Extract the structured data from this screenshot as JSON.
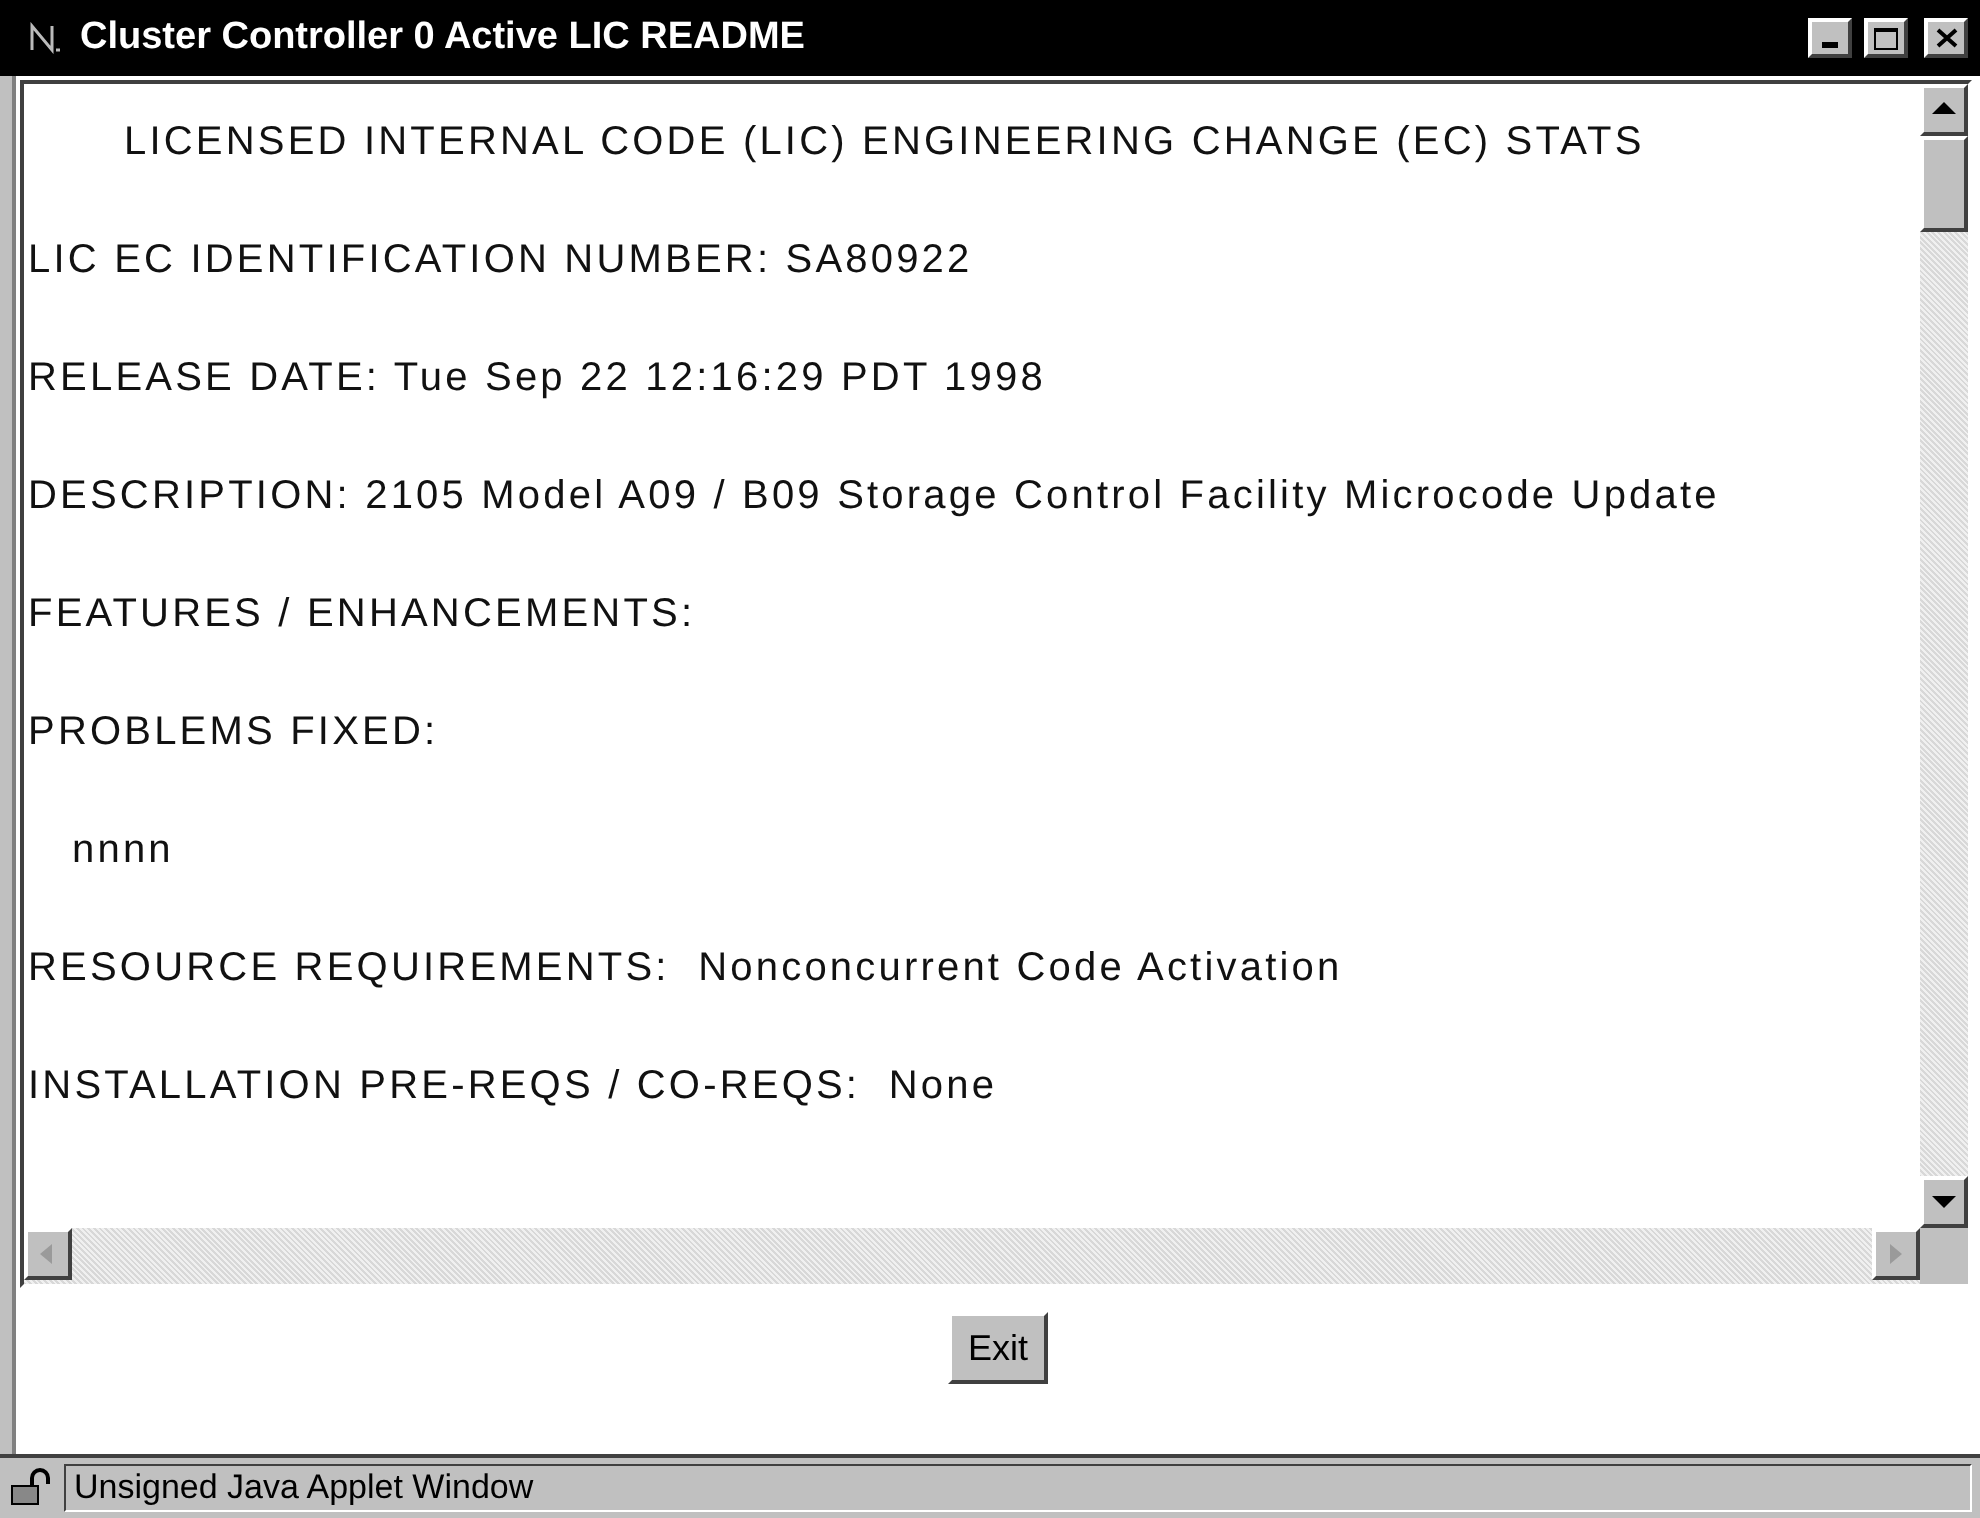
{
  "window": {
    "title": "Cluster Controller 0 Active LIC README"
  },
  "document": {
    "lines": [
      {
        "kind": "title",
        "text": "LICENSED INTERNAL CODE (LIC) ENGINEERING CHANGE (EC) STATS"
      },
      {
        "kind": "line",
        "text": "LIC EC IDENTIFICATION NUMBER: SA80922"
      },
      {
        "kind": "line",
        "text": "RELEASE DATE: Tue Sep 22 12:16:29 PDT 1998"
      },
      {
        "kind": "line",
        "text": "DESCRIPTION: 2105 Model A09 / B09 Storage Control Facility Microcode Update"
      },
      {
        "kind": "line",
        "text": "FEATURES / ENHANCEMENTS:"
      },
      {
        "kind": "line",
        "text": "PROBLEMS FIXED:"
      },
      {
        "kind": "indent",
        "text": "nnnn"
      },
      {
        "kind": "line",
        "text": "RESOURCE REQUIREMENTS:  Nonconcurrent Code Activation"
      },
      {
        "kind": "line",
        "text": "INSTALLATION PRE-REQS / CO-REQS:  None"
      }
    ]
  },
  "buttons": [
    "Exit"
  ],
  "status_bar": {
    "text": "Unsigned Java Applet Window"
  }
}
